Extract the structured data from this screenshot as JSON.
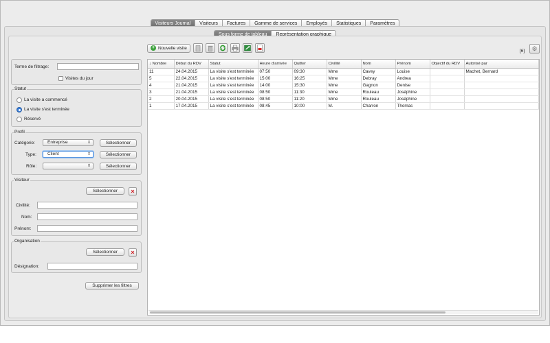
{
  "nav": {
    "tabs": [
      {
        "label": "Visiteurs Journal",
        "active": true
      },
      {
        "label": "Visiteurs"
      },
      {
        "label": "Factures"
      },
      {
        "label": "Gamme de services"
      },
      {
        "label": "Employés"
      },
      {
        "label": "Statistiques"
      },
      {
        "label": "Paramètres"
      }
    ],
    "subtabs": [
      {
        "label": "Sous forme de tableau",
        "active": true
      },
      {
        "label": "Représentation graphique"
      }
    ]
  },
  "toolbar": {
    "new_visit": "Nouvelle visite",
    "icons": [
      "edit-icon",
      "delete-icon",
      "refresh-icon",
      "print-icon",
      "export-excel-icon",
      "export-pdf-icon"
    ],
    "count": "[6]"
  },
  "filters": {
    "term_label": "Terme de filtrage:",
    "term_value": "",
    "today_label": "Visites du jour",
    "today_checked": false,
    "statut": {
      "legend": "Statut",
      "options": [
        "La visite a commencé",
        "La visite s'est terminée",
        "Réservé"
      ],
      "selected": 1
    },
    "profil": {
      "legend": "Profil",
      "categorie_label": "Catégorie:",
      "categorie_value": "Entreprise",
      "type_label": "Type:",
      "type_value": "Client",
      "role_label": "Rôle:",
      "role_value": "",
      "select_btn": "Sélectionner"
    },
    "visiteur": {
      "legend": "Visiteur",
      "select_btn": "Sélectionner",
      "civilite_label": "Civilité:",
      "nom_label": "Nom:",
      "prenom_label": "Prénom:"
    },
    "organisation": {
      "legend": "Organisation",
      "select_btn": "Sélectionner",
      "designation_label": "Désignation:"
    },
    "clear_btn": "Supprimer les filtres"
  },
  "table": {
    "columns": [
      "↓ Nombre",
      "Début du RDV",
      "Statut",
      "Heure d'arrivée",
      "Quitter",
      "Civilité",
      "Nom",
      "Prénom",
      "Objectif du RDV",
      "Autorisé par"
    ],
    "rows": [
      [
        "11",
        "24.04.2015",
        "La visite s'est terminée",
        "07:50",
        "09:30",
        "Mme",
        "Cavey",
        "Louise",
        "",
        "Machet, Bernard"
      ],
      [
        "5",
        "22.04.2015",
        "La visite s'est terminée",
        "15:00",
        "16:25",
        "Mme",
        "Debray",
        "Andrea",
        "",
        ""
      ],
      [
        "4",
        "21.04.2015",
        "La visite s'est terminée",
        "14:00",
        "15:30",
        "Mme",
        "Gagnon",
        "Denise",
        "",
        ""
      ],
      [
        "3",
        "21.04.2015",
        "La visite s'est terminée",
        "08:50",
        "11:30",
        "Mme",
        "Rouleau",
        "Joséphine",
        "",
        ""
      ],
      [
        "2",
        "20.04.2015",
        "La visite s'est terminée",
        "08:50",
        "11:20",
        "Mme",
        "Rouleau",
        "Joséphine",
        "",
        ""
      ],
      [
        "1",
        "17.04.2015",
        "La visite s'est terminée",
        "08:45",
        "10:00",
        "M.",
        "Charron",
        "Thomas",
        "",
        ""
      ]
    ]
  }
}
